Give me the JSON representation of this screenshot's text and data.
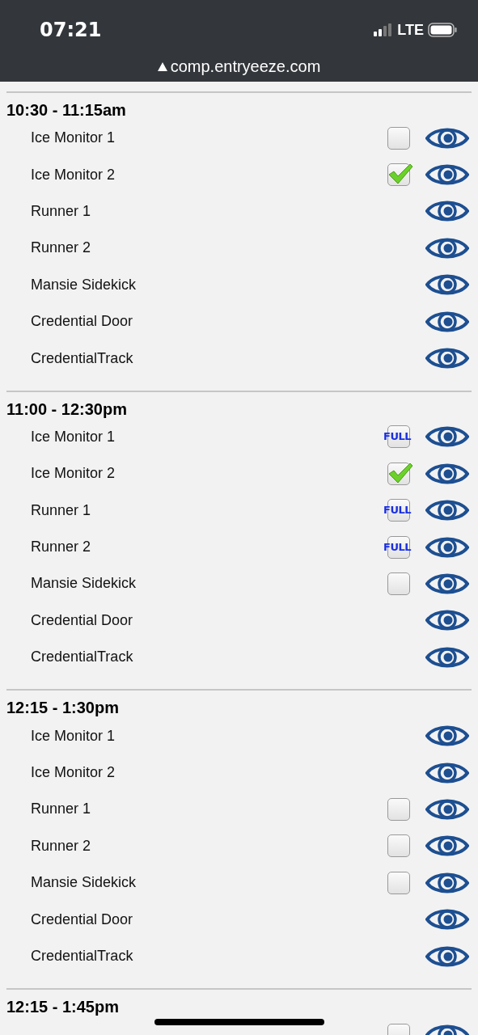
{
  "status_bar": {
    "time": "07:21",
    "network": "LTE"
  },
  "address_bar": {
    "url": "comp.entryeeze.com"
  },
  "sections": [
    {
      "title": "10:30 - 11:15am",
      "rows": [
        {
          "label": "Ice Monitor 1",
          "kind": "checkbox",
          "checked": false
        },
        {
          "label": "Ice Monitor 2",
          "kind": "checkbox",
          "checked": true
        },
        {
          "label": "Runner 1",
          "kind": "none"
        },
        {
          "label": "Runner 2",
          "kind": "none"
        },
        {
          "label": "Mansie Sidekick",
          "kind": "none"
        },
        {
          "label": "Credential Door",
          "kind": "none"
        },
        {
          "label": "CredentialTrack",
          "kind": "none"
        }
      ]
    },
    {
      "title": "11:00 - 12:30pm",
      "rows": [
        {
          "label": "Ice Monitor 1",
          "kind": "full",
          "badge": "FULL"
        },
        {
          "label": "Ice Monitor 2",
          "kind": "checkbox",
          "checked": true
        },
        {
          "label": "Runner 1",
          "kind": "full",
          "badge": "FULL"
        },
        {
          "label": "Runner 2",
          "kind": "full",
          "badge": "FULL"
        },
        {
          "label": "Mansie Sidekick",
          "kind": "checkbox",
          "checked": false
        },
        {
          "label": "Credential Door",
          "kind": "none"
        },
        {
          "label": "CredentialTrack",
          "kind": "none"
        }
      ]
    },
    {
      "title": "12:15 - 1:30pm",
      "rows": [
        {
          "label": "Ice Monitor 1",
          "kind": "none"
        },
        {
          "label": "Ice Monitor 2",
          "kind": "none"
        },
        {
          "label": "Runner 1",
          "kind": "checkbox",
          "checked": false
        },
        {
          "label": "Runner 2",
          "kind": "checkbox",
          "checked": false
        },
        {
          "label": "Mansie Sidekick",
          "kind": "checkbox",
          "checked": false
        },
        {
          "label": "Credential Door",
          "kind": "none"
        },
        {
          "label": "CredentialTrack",
          "kind": "none"
        }
      ]
    },
    {
      "title": "12:15 - 1:45pm",
      "rows": [
        {
          "kind": "checkbox",
          "checked": false
        }
      ]
    }
  ]
}
